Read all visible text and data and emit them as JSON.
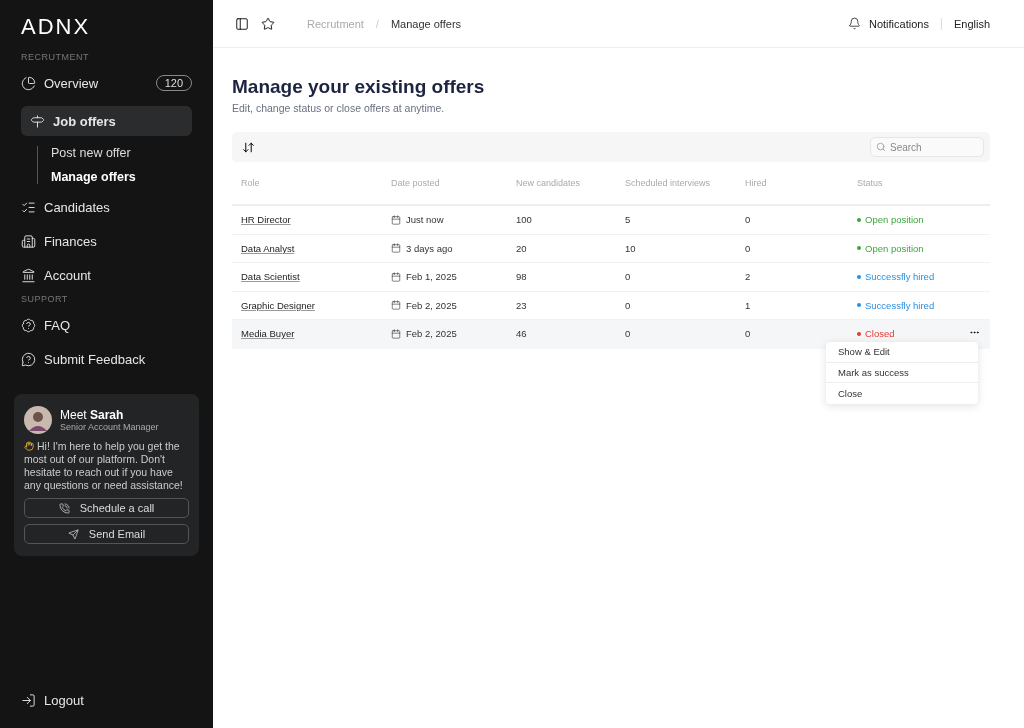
{
  "sidebar": {
    "logo": "ADNX",
    "sections": [
      {
        "heading": "RECRUTMENT",
        "items": [
          {
            "label": "Overview",
            "badge": "120",
            "selected": false
          },
          {
            "label": "Job offers",
            "selected": true,
            "children": [
              {
                "label": "Post new offer",
                "selected": false
              },
              {
                "label": "Manage offers",
                "selected": true
              }
            ]
          },
          {
            "label": "Candidates",
            "selected": false
          },
          {
            "label": "Finances",
            "selected": false
          },
          {
            "label": "Account",
            "selected": false
          }
        ]
      },
      {
        "heading": "SUPPORT",
        "items": [
          {
            "label": "FAQ",
            "selected": false
          },
          {
            "label": "Submit Feedback",
            "selected": false
          }
        ]
      }
    ],
    "contact_card": {
      "greeting": "Meet **Sarah**",
      "role": "Senior Account Manager",
      "message": "Hi! I'm here to help you get the most out of our platform. Don't hesitate to reach out if you have any questions or need assistance!",
      "buttons": [
        "Schedule a call",
        "Send Email"
      ]
    },
    "logout": "Logout"
  },
  "header": {
    "separator": "/",
    "breadcrumbs": [
      {
        "label": "Recrutment",
        "selected": false
      },
      {
        "label": "Manage offers",
        "selected": true
      }
    ],
    "notifications": "Notifications",
    "language": "English"
  },
  "page": {
    "title": "Manage your existing offers",
    "subtitle": "Edit, change status or close offers at anytime."
  },
  "table": {
    "search": {
      "placeholder": "Search"
    },
    "columns": [
      "Role",
      "Date posted",
      "New candidates",
      "Scheduled interviews",
      "Hired",
      "Status"
    ],
    "rows": [
      {
        "role": "HR Director",
        "date": "Just now",
        "new_candidates": "100",
        "interviews": "5",
        "hired": "0",
        "status": {
          "label": "Open position",
          "color": "#3ca63c"
        },
        "selected": false
      },
      {
        "role": "Data Analyst",
        "date": "3 days ago",
        "new_candidates": "20",
        "interviews": "10",
        "hired": "0",
        "status": {
          "label": "Open position",
          "color": "#3ca63c"
        },
        "selected": false
      },
      {
        "role": "Data Scientist",
        "date": "Feb 1, 2025",
        "new_candidates": "98",
        "interviews": "0",
        "hired": "2",
        "status": {
          "label": "Successfly hired",
          "color": "#2b8fe0"
        },
        "selected": false
      },
      {
        "role": "Graphic Designer",
        "date": "Feb 2, 2025",
        "new_candidates": "23",
        "interviews": "0",
        "hired": "1",
        "status": {
          "label": "Successfly hired",
          "color": "#2b8fe0"
        },
        "selected": false
      },
      {
        "role": "Media Buyer",
        "date": "Feb 2, 2025",
        "new_candidates": "46",
        "interviews": "0",
        "hired": "0",
        "status": {
          "label": "Closed",
          "color": "#e53935"
        },
        "selected": true,
        "menu": [
          "Show & Edit",
          "Mark as success",
          "Close"
        ]
      }
    ]
  }
}
